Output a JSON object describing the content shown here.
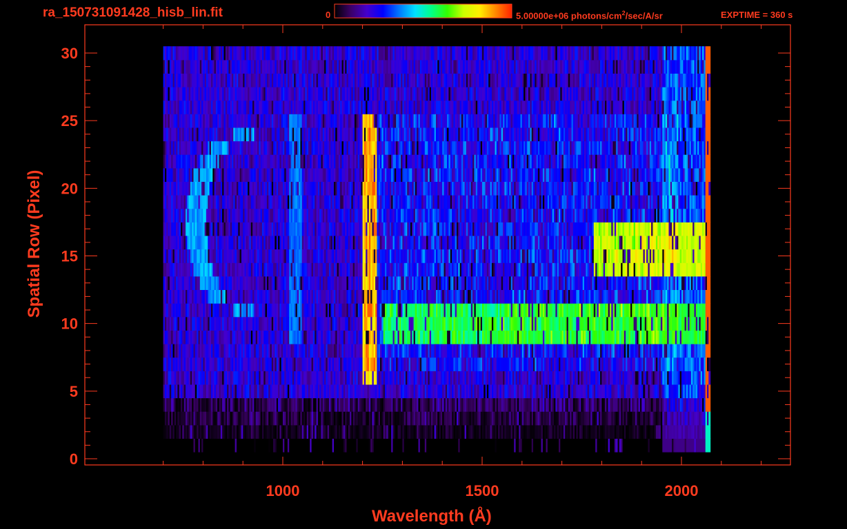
{
  "file_title": "ra_150731091428_hisb_lin.fit",
  "colorbar": {
    "min_label": "0",
    "max_value": "5.00000e+06",
    "units_pre": " photons/cm",
    "units_sup": "2",
    "units_post": "/sec/A/sr",
    "colors": [
      "#000000",
      "#3b0066",
      "#4400cc",
      "#0000ff",
      "#0077ff",
      "#00e0ff",
      "#00ff88",
      "#33ff00",
      "#ccff00",
      "#ffee00",
      "#ff8800",
      "#ff2200"
    ]
  },
  "exptime": "EXPTIME = 360 s",
  "axis_color": "#ff3b1f",
  "chart_data": {
    "type": "heatmap",
    "xlabel": "Wavelength (Å)",
    "ylabel": "Spatial Row (Pixel)",
    "xlim": [
      600,
      2250
    ],
    "ylim": [
      -0.5,
      30.5
    ],
    "xticks": [
      1000,
      1500,
      2000
    ],
    "yticks": [
      0,
      5,
      10,
      15,
      20,
      25,
      30
    ],
    "data_x_range": [
      700,
      2070
    ],
    "data_y_range": [
      0,
      30
    ],
    "features": [
      {
        "label": "Lyman-alpha line",
        "wavelength": 1216,
        "rows": [
          5,
          24
        ],
        "intensity": 0.85
      },
      {
        "label": "continuum band",
        "wavelength_range": [
          1250,
          2060
        ],
        "rows": [
          8,
          10
        ],
        "intensity": 0.55
      },
      {
        "label": "continuum band",
        "wavelength_range": [
          1780,
          2060
        ],
        "rows": [
          13,
          16
        ],
        "intensity": 0.7
      },
      {
        "label": "arc",
        "wavelength_range": [
          780,
          900
        ],
        "rows": [
          10,
          23
        ],
        "intensity": 0.45
      },
      {
        "label": "emission line",
        "wavelength": 1030,
        "rows": [
          8,
          24
        ],
        "intensity": 0.4
      }
    ]
  }
}
